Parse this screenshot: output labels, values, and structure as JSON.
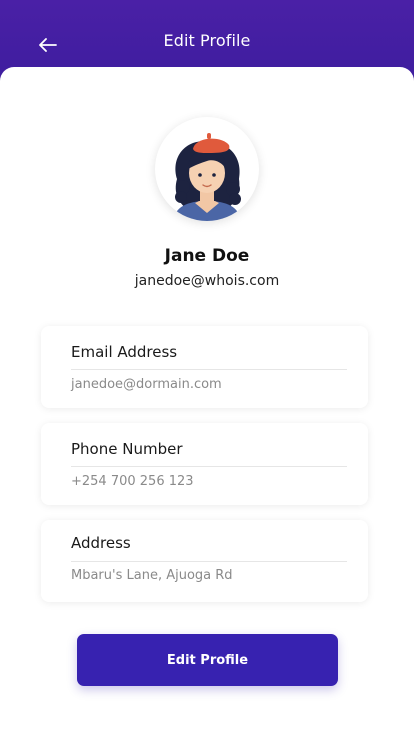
{
  "header": {
    "title": "Edit Profile",
    "back_icon": "arrow-left-icon",
    "background": "#4a20a6"
  },
  "profile": {
    "avatar_icon": "user-avatar-illustration",
    "name": "Jane Doe",
    "email": "janedoe@whois.com"
  },
  "fields": [
    {
      "label": "Email Address",
      "value": "janedoe@dormain.com"
    },
    {
      "label": "Phone Number",
      "value": "+254 700 256 123"
    },
    {
      "label": "Address",
      "value": "Mbaru's Lane, Ajuoga Rd"
    }
  ],
  "actions": {
    "edit_label": "Edit Profile",
    "edit_color": "#3722b0"
  }
}
